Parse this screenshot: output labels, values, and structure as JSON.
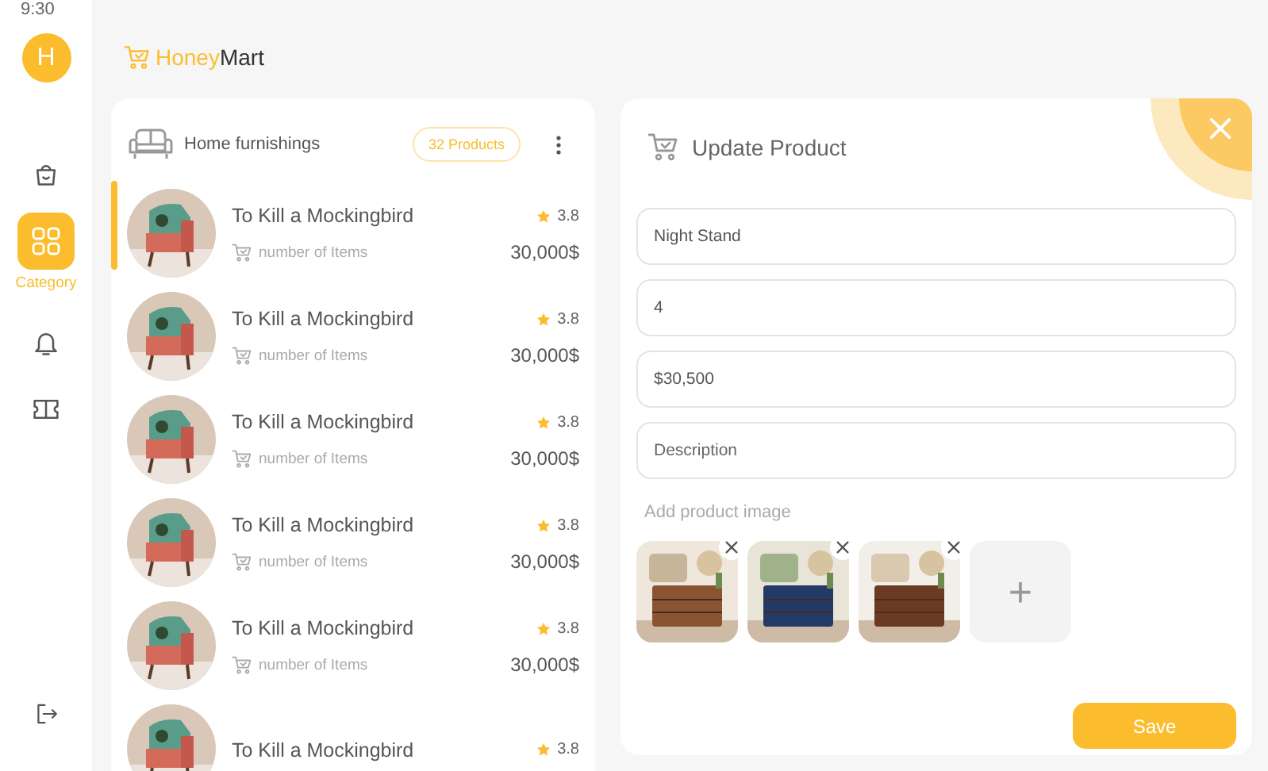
{
  "status_bar": {
    "time": "9:30"
  },
  "user": {
    "initial": "H"
  },
  "sidebar": {
    "items": [
      {
        "kind": "bag",
        "selected": false
      },
      {
        "kind": "grid",
        "label": "Category",
        "selected": true
      },
      {
        "kind": "bell",
        "selected": false
      },
      {
        "kind": "ticket",
        "selected": false
      }
    ]
  },
  "logo": {
    "first": "Honey",
    "second": "Mart"
  },
  "category": {
    "title": "Home furnishings",
    "count": "32 Products"
  },
  "products": [
    {
      "name": "To Kill a Mockingbird",
      "rating": "3.8",
      "items_label": "number of Items",
      "price": "30,000$",
      "selected": true
    },
    {
      "name": "To Kill a Mockingbird",
      "rating": "3.8",
      "items_label": "number of Items",
      "price": "30,000$",
      "selected": false
    },
    {
      "name": "To Kill a Mockingbird",
      "rating": "3.8",
      "items_label": "number of Items",
      "price": "30,000$",
      "selected": false
    },
    {
      "name": "To Kill a Mockingbird",
      "rating": "3.8",
      "items_label": "number of Items",
      "price": "30,000$",
      "selected": false
    },
    {
      "name": "To Kill a Mockingbird",
      "rating": "3.8",
      "items_label": "number of Items",
      "price": "30,000$",
      "selected": false
    },
    {
      "name": "To Kill a Mockingbird",
      "rating": "3.8",
      "selected": false
    }
  ],
  "update": {
    "title": "Update Product",
    "fields": [
      {
        "value": "Night Stand"
      },
      {
        "value": "4"
      },
      {
        "value": "$30,500"
      },
      {
        "placeholder": "Description"
      }
    ],
    "images_label": "Add product image",
    "add_symbol": "+",
    "save": "Save"
  }
}
